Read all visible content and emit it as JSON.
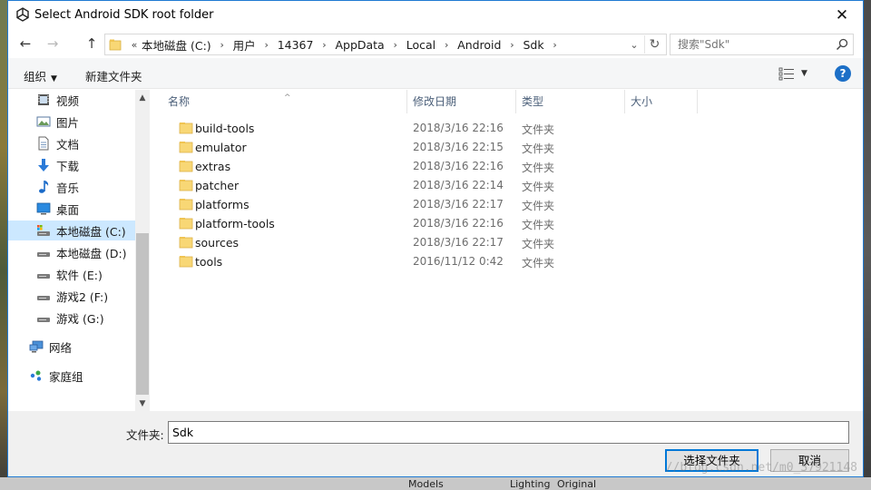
{
  "window": {
    "title": "Select Android SDK root folder",
    "close_glyph": "✕"
  },
  "nav": {
    "back_glyph": "←",
    "forward_glyph": "→",
    "up_glyph": "↑",
    "overflow_glyph": "«",
    "breadcrumbs": [
      "本地磁盘 (C:)",
      "用户",
      "14367",
      "AppData",
      "Local",
      "Android",
      "Sdk"
    ],
    "separator": "›",
    "dropdown_glyph": "⌄",
    "refresh_glyph": "↻",
    "search_placeholder": "搜索\"Sdk\""
  },
  "toolbar": {
    "organize_label": "组织",
    "organize_caret": "▼",
    "new_folder_label": "新建文件夹",
    "view_caret": "▼",
    "help_glyph": "?"
  },
  "sidebar": {
    "items": [
      {
        "label": "视频",
        "icon": "video-icon"
      },
      {
        "label": "图片",
        "icon": "pictures-icon"
      },
      {
        "label": "文档",
        "icon": "documents-icon"
      },
      {
        "label": "下载",
        "icon": "download-icon"
      },
      {
        "label": "音乐",
        "icon": "music-icon"
      },
      {
        "label": "桌面",
        "icon": "desktop-icon"
      },
      {
        "label": "本地磁盘 (C:)",
        "icon": "system-drive-icon",
        "selected": true
      },
      {
        "label": "本地磁盘 (D:)",
        "icon": "drive-icon"
      },
      {
        "label": "软件 (E:)",
        "icon": "drive-icon"
      },
      {
        "label": "游戏2 (F:)",
        "icon": "drive-icon"
      },
      {
        "label": "游戏 (G:)",
        "icon": "drive-icon"
      },
      {
        "label": "网络",
        "icon": "network-icon"
      },
      {
        "label": "家庭组",
        "icon": "homegroup-icon"
      }
    ],
    "scroll_up_glyph": "▲",
    "scroll_down_glyph": "▼"
  },
  "filelist": {
    "columns": {
      "name": "名称",
      "date": "修改日期",
      "type": "类型",
      "size": "大小"
    },
    "sort_glyph": "^",
    "rows": [
      {
        "name": "build-tools",
        "date": "2018/3/16 22:16",
        "type": "文件夹"
      },
      {
        "name": "emulator",
        "date": "2018/3/16 22:15",
        "type": "文件夹"
      },
      {
        "name": "extras",
        "date": "2018/3/16 22:16",
        "type": "文件夹"
      },
      {
        "name": "patcher",
        "date": "2018/3/16 22:14",
        "type": "文件夹"
      },
      {
        "name": "platforms",
        "date": "2018/3/16 22:17",
        "type": "文件夹"
      },
      {
        "name": "platform-tools",
        "date": "2018/3/16 22:16",
        "type": "文件夹"
      },
      {
        "name": "sources",
        "date": "2018/3/16 22:17",
        "type": "文件夹"
      },
      {
        "name": "tools",
        "date": "2016/11/12 0:42",
        "type": "文件夹"
      }
    ]
  },
  "footer": {
    "folder_label": "文件夹:",
    "folder_value": "Sdk",
    "select_button": "选择文件夹",
    "cancel_button": "取消"
  },
  "background": {
    "tabs": [
      "Models",
      "Lighting",
      "Original"
    ]
  },
  "watermark": "//blog.csdn.net/m0_37921148",
  "colors": {
    "accent": "#0078d7",
    "selected_bg": "#cce8ff",
    "folder_yellow": "#f8d775",
    "header_text": "#4c607a"
  }
}
